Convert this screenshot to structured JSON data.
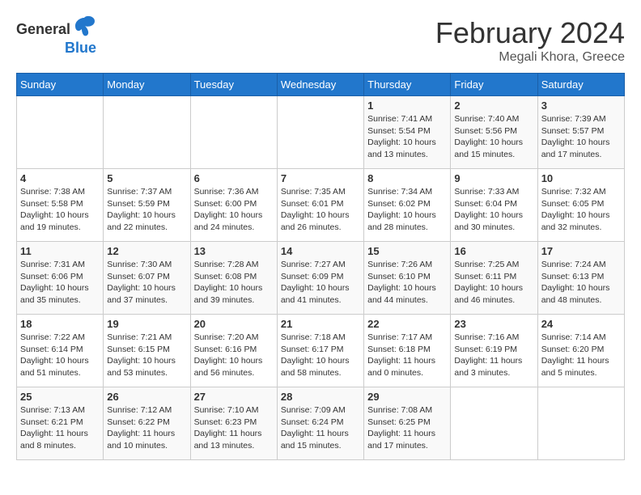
{
  "header": {
    "logo_general": "General",
    "logo_blue": "Blue",
    "title": "February 2024",
    "subtitle": "Megali Khora, Greece"
  },
  "days_of_week": [
    "Sunday",
    "Monday",
    "Tuesday",
    "Wednesday",
    "Thursday",
    "Friday",
    "Saturday"
  ],
  "weeks": [
    [
      {
        "day": "",
        "info": ""
      },
      {
        "day": "",
        "info": ""
      },
      {
        "day": "",
        "info": ""
      },
      {
        "day": "",
        "info": ""
      },
      {
        "day": "1",
        "info": "Sunrise: 7:41 AM\nSunset: 5:54 PM\nDaylight: 10 hours and 13 minutes."
      },
      {
        "day": "2",
        "info": "Sunrise: 7:40 AM\nSunset: 5:56 PM\nDaylight: 10 hours and 15 minutes."
      },
      {
        "day": "3",
        "info": "Sunrise: 7:39 AM\nSunset: 5:57 PM\nDaylight: 10 hours and 17 minutes."
      }
    ],
    [
      {
        "day": "4",
        "info": "Sunrise: 7:38 AM\nSunset: 5:58 PM\nDaylight: 10 hours and 19 minutes."
      },
      {
        "day": "5",
        "info": "Sunrise: 7:37 AM\nSunset: 5:59 PM\nDaylight: 10 hours and 22 minutes."
      },
      {
        "day": "6",
        "info": "Sunrise: 7:36 AM\nSunset: 6:00 PM\nDaylight: 10 hours and 24 minutes."
      },
      {
        "day": "7",
        "info": "Sunrise: 7:35 AM\nSunset: 6:01 PM\nDaylight: 10 hours and 26 minutes."
      },
      {
        "day": "8",
        "info": "Sunrise: 7:34 AM\nSunset: 6:02 PM\nDaylight: 10 hours and 28 minutes."
      },
      {
        "day": "9",
        "info": "Sunrise: 7:33 AM\nSunset: 6:04 PM\nDaylight: 10 hours and 30 minutes."
      },
      {
        "day": "10",
        "info": "Sunrise: 7:32 AM\nSunset: 6:05 PM\nDaylight: 10 hours and 32 minutes."
      }
    ],
    [
      {
        "day": "11",
        "info": "Sunrise: 7:31 AM\nSunset: 6:06 PM\nDaylight: 10 hours and 35 minutes."
      },
      {
        "day": "12",
        "info": "Sunrise: 7:30 AM\nSunset: 6:07 PM\nDaylight: 10 hours and 37 minutes."
      },
      {
        "day": "13",
        "info": "Sunrise: 7:28 AM\nSunset: 6:08 PM\nDaylight: 10 hours and 39 minutes."
      },
      {
        "day": "14",
        "info": "Sunrise: 7:27 AM\nSunset: 6:09 PM\nDaylight: 10 hours and 41 minutes."
      },
      {
        "day": "15",
        "info": "Sunrise: 7:26 AM\nSunset: 6:10 PM\nDaylight: 10 hours and 44 minutes."
      },
      {
        "day": "16",
        "info": "Sunrise: 7:25 AM\nSunset: 6:11 PM\nDaylight: 10 hours and 46 minutes."
      },
      {
        "day": "17",
        "info": "Sunrise: 7:24 AM\nSunset: 6:13 PM\nDaylight: 10 hours and 48 minutes."
      }
    ],
    [
      {
        "day": "18",
        "info": "Sunrise: 7:22 AM\nSunset: 6:14 PM\nDaylight: 10 hours and 51 minutes."
      },
      {
        "day": "19",
        "info": "Sunrise: 7:21 AM\nSunset: 6:15 PM\nDaylight: 10 hours and 53 minutes."
      },
      {
        "day": "20",
        "info": "Sunrise: 7:20 AM\nSunset: 6:16 PM\nDaylight: 10 hours and 56 minutes."
      },
      {
        "day": "21",
        "info": "Sunrise: 7:18 AM\nSunset: 6:17 PM\nDaylight: 10 hours and 58 minutes."
      },
      {
        "day": "22",
        "info": "Sunrise: 7:17 AM\nSunset: 6:18 PM\nDaylight: 11 hours and 0 minutes."
      },
      {
        "day": "23",
        "info": "Sunrise: 7:16 AM\nSunset: 6:19 PM\nDaylight: 11 hours and 3 minutes."
      },
      {
        "day": "24",
        "info": "Sunrise: 7:14 AM\nSunset: 6:20 PM\nDaylight: 11 hours and 5 minutes."
      }
    ],
    [
      {
        "day": "25",
        "info": "Sunrise: 7:13 AM\nSunset: 6:21 PM\nDaylight: 11 hours and 8 minutes."
      },
      {
        "day": "26",
        "info": "Sunrise: 7:12 AM\nSunset: 6:22 PM\nDaylight: 11 hours and 10 minutes."
      },
      {
        "day": "27",
        "info": "Sunrise: 7:10 AM\nSunset: 6:23 PM\nDaylight: 11 hours and 13 minutes."
      },
      {
        "day": "28",
        "info": "Sunrise: 7:09 AM\nSunset: 6:24 PM\nDaylight: 11 hours and 15 minutes."
      },
      {
        "day": "29",
        "info": "Sunrise: 7:08 AM\nSunset: 6:25 PM\nDaylight: 11 hours and 17 minutes."
      },
      {
        "day": "",
        "info": ""
      },
      {
        "day": "",
        "info": ""
      }
    ]
  ]
}
